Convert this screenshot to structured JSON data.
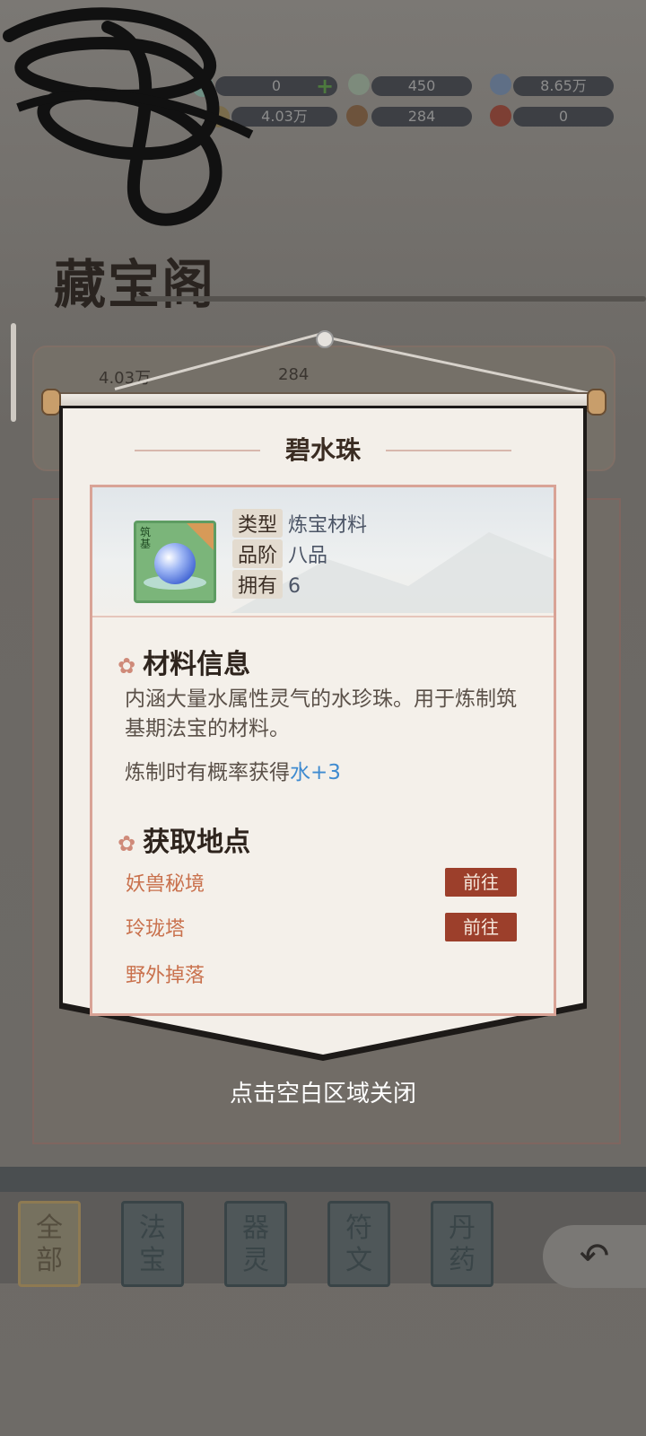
{
  "resources": {
    "row1": [
      "0",
      "450",
      "8.65万"
    ],
    "row2": [
      "4.03万",
      "284",
      "0"
    ]
  },
  "hall_title": "藏宝阁",
  "background_chips": [
    "4.03万",
    "284"
  ],
  "tabs": [
    "全\n部",
    "法\n宝",
    "器\n灵",
    "符\n文",
    "丹\n药"
  ],
  "back_icon": "back-arrow-icon",
  "dialog": {
    "title": "碧水珠",
    "item_icon_label": "筑基",
    "attrs": [
      {
        "key": "类型",
        "value": "炼宝材料"
      },
      {
        "key": "品阶",
        "value": "八品"
      },
      {
        "key": "拥有",
        "value": "6"
      }
    ],
    "info_title": "材料信息",
    "info_desc": "内涵大量水属性灵气的水珍珠。用于炼制筑基期法宝的材料。",
    "refine_prefix": "炼制时有概率获得",
    "refine_bonus": "水+3",
    "source_title": "获取地点",
    "sources": [
      {
        "name": "妖兽秘境",
        "button": "前往"
      },
      {
        "name": "玲珑塔",
        "button": "前往"
      },
      {
        "name": "野外掉落"
      }
    ]
  },
  "close_hint": "点击空白区域关闭",
  "colors": {
    "accent_button": "#9c3f2b",
    "bonus_text": "#3f8bd0",
    "source_text": "#c9714d"
  }
}
